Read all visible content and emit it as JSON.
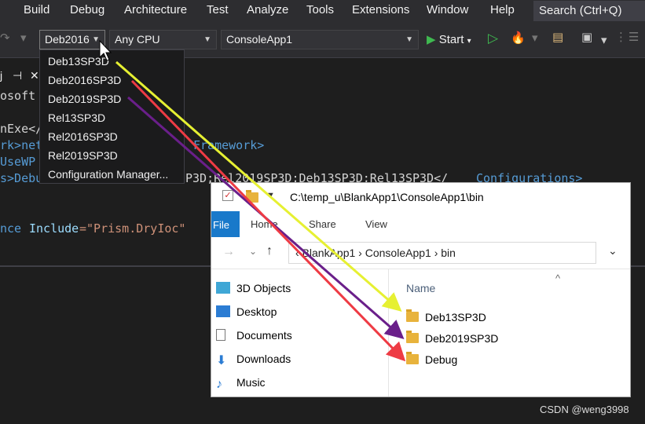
{
  "menubar": {
    "items": [
      "Build",
      "Debug",
      "Architecture",
      "Test",
      "Analyze",
      "Tools",
      "Extensions",
      "Window",
      "Help"
    ],
    "search_placeholder": "Search (Ctrl+Q)"
  },
  "toolbar": {
    "config_value": "Deb2016",
    "platform_value": "Any CPU",
    "project_value": "ConsoleApp1",
    "start_label": "Start"
  },
  "config_dropdown": {
    "options": [
      "Deb13SP3D",
      "Deb2016SP3D",
      "Deb2019SP3D",
      "Rel13SP3D",
      "Rel2016SP3D",
      "Rel2019SP3D",
      "Configuration Manager..."
    ]
  },
  "editor": {
    "lines": [
      {
        "text": "osoft"
      },
      {
        "text": "nExe</"
      },
      {
        "text": "rk>net"
      },
      {
        "text": "UseWP"
      },
      {
        "text": "s>Debu"
      },
      {
        "text": "Framework>"
      },
      {
        "text": "P3D;Rel2019SP3D;Deb13SP3D;Rel13SP3D</"
      },
      {
        "text": "Configurations>"
      },
      {
        "text": "nce"
      },
      {
        "text": "Include"
      },
      {
        "text": "=\"Prism.DryIoc\""
      }
    ]
  },
  "explorer": {
    "path": "C:\\temp_u\\BlankApp1\\ConsoleApp1\\bin",
    "ribbon_tabs": [
      "File",
      "Home",
      "Share",
      "View"
    ],
    "breadcrumb": [
      "BlankApp1",
      "ConsoleApp1",
      "bin"
    ],
    "nav_items": [
      "3D Objects",
      "Desktop",
      "Documents",
      "Downloads",
      "Music"
    ],
    "column_header": "Name",
    "folders": [
      "Deb13SP3D",
      "Deb2019SP3D",
      "Debug"
    ]
  },
  "arrows": {
    "colors": [
      "#e6f032",
      "#6a1f8a",
      "#ee3b44"
    ]
  },
  "watermark": "CSDN @weng3998"
}
